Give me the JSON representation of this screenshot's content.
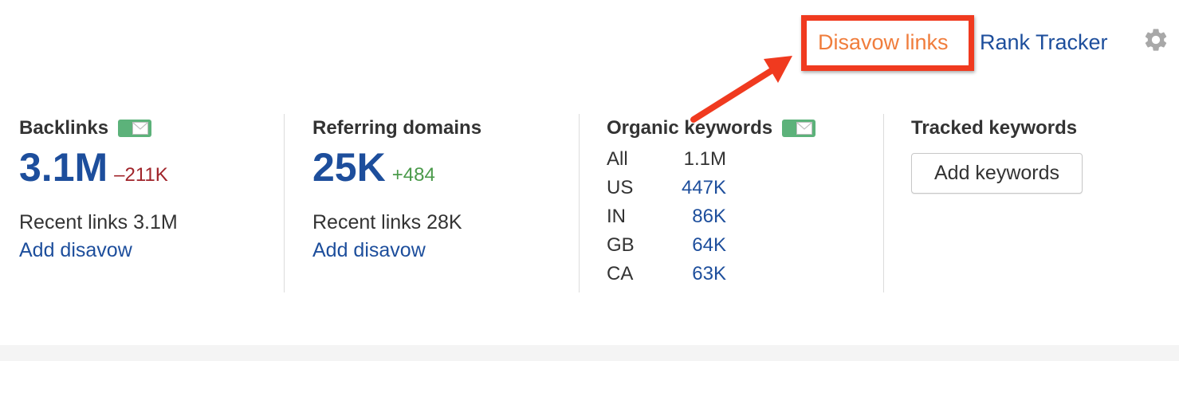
{
  "header": {
    "disavow_links_label": "Disavow links",
    "rank_tracker_label": "Rank Tracker",
    "settings_icon": "gear-icon",
    "disavow_color": "#f07d3c",
    "highlight_color": "#f03a1f"
  },
  "backlinks": {
    "title": "Backlinks",
    "value": "3.1M",
    "delta": "–211K",
    "recent_links": "Recent links 3.1M",
    "add_disavow_label": "Add disavow"
  },
  "referring_domains": {
    "title": "Referring domains",
    "value": "25K",
    "delta": "+484",
    "recent_links": "Recent links 28K",
    "add_disavow_label": "Add disavow"
  },
  "organic_keywords": {
    "title": "Organic keywords",
    "rows": [
      {
        "country": "All",
        "value": "1.1M"
      },
      {
        "country": "US",
        "value": "447K"
      },
      {
        "country": "IN",
        "value": "86K"
      },
      {
        "country": "GB",
        "value": "64K"
      },
      {
        "country": "CA",
        "value": "63K"
      }
    ]
  },
  "tracked_keywords": {
    "title": "Tracked keywords",
    "add_keywords_label": "Add keywords"
  },
  "colors": {
    "link_blue": "#1d4e9c",
    "negative_red": "#a0242a",
    "positive_green": "#4a9a4a",
    "badge_green": "#5cb27a"
  }
}
